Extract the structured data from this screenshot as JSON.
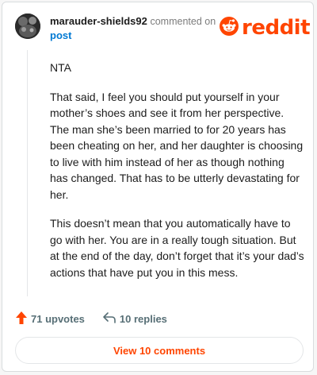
{
  "comment": {
    "username": "marauder-shields92",
    "commented_on_text": "commented on",
    "post_link_label": "post",
    "paragraphs": [
      "NTA",
      "That said, I feel you should put yourself in your mother’s shoes and see it from her perspective. The man she’s been married to for 20 years has been cheating on her, and her daughter is choosing to live with him instead of her as though nothing has changed. That has to be utterly devastating for her.",
      "This doesn’t mean that you automatically have to go with her. You are in a really tough situation. But at the end of the day, don’t forget that it’s your dad’s actions that have put you in this mess."
    ]
  },
  "brand": {
    "logo_text": "reddit",
    "logo_icon": "reddit-alien-icon",
    "color": "#ff4500"
  },
  "actions": {
    "upvotes": "71 upvotes",
    "upvote_icon": "upvote-arrow-icon",
    "replies": "10 replies",
    "reply_icon": "reply-arrow-icon"
  },
  "footer": {
    "view_comments_label": "View 10 comments"
  },
  "colors": {
    "accent": "#ff4500",
    "link": "#0079d3",
    "text": "#1c1c1c",
    "muted": "#576f76"
  }
}
